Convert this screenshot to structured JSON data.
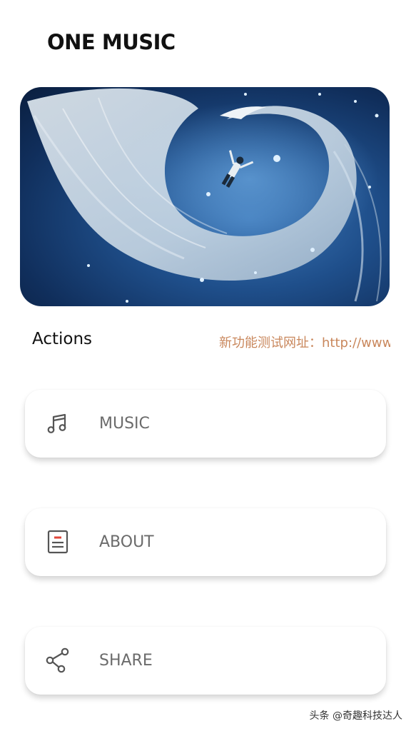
{
  "app": {
    "title": "ONE MUSIC"
  },
  "hero": {
    "image": "bird-spiral-illustration"
  },
  "actions": {
    "label": "Actions",
    "marquee_text": "新功能测试网址：http://www"
  },
  "menu": [
    {
      "label": "MUSIC",
      "icon": "music-note-icon"
    },
    {
      "label": "ABOUT",
      "icon": "document-icon"
    },
    {
      "label": "SHARE",
      "icon": "share-icon"
    }
  ],
  "watermark": "头条 @奇趣科技达人",
  "colors": {
    "accent": "#c9875c",
    "label": "#6b6b6b",
    "icon_red": "#e0463a"
  }
}
